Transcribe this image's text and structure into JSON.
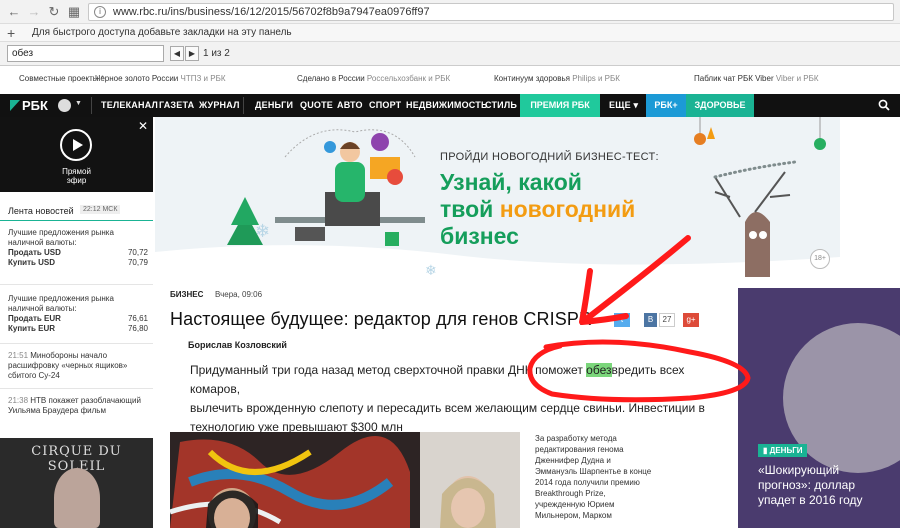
{
  "browser": {
    "url": "www.rbc.ru/ins/business/16/12/2015/56702f8b9a7947ea0976ff97",
    "bookmarks_hint": "Для быстрого доступа добавьте закладки на эту панель",
    "find": {
      "query": "обез",
      "count": "1 из 2"
    }
  },
  "promos": [
    {
      "label": "Совместные проекты",
      "mark": "*",
      "sub": ""
    },
    {
      "label": "Черное золото России",
      "mark": "",
      "sub": "ЧТПЗ и РБК"
    },
    {
      "label": "Сделано в России",
      "mark": "",
      "sub": "Россельхозбанк и РБК"
    },
    {
      "label": "Континуум здоровья",
      "mark": "",
      "sub": "Philips и РБК"
    },
    {
      "label": "Паблик чат РБК Viber",
      "mark": "",
      "sub": "Viber и РБК"
    }
  ],
  "nav": {
    "logo": "РБК",
    "items": [
      "ТЕЛЕКАНАЛ",
      "ГАЗЕТА",
      "ЖУРНАЛ",
      "ДЕНЬГИ",
      "QUOTE",
      "АВТО",
      "СПОРТ",
      "НЕДВИЖИМОСТЬ",
      "СТИЛЬ"
    ],
    "premium": "ПРЕМИЯ РБК",
    "more": "ЕЩЕ",
    "plus": "РБК+",
    "health": "ЗДОРОВЬЕ"
  },
  "live": {
    "label_1": "Прямой",
    "label_2": "эфир"
  },
  "news": {
    "heading": "Лента новостей",
    "time_badge": "22:12 МСК",
    "usd": {
      "title_1": "Лучшие предложения рынка",
      "title_2": "наличной валюты:",
      "sell_label": "Продать USD",
      "sell_value": "70,72",
      "buy_label": "Купить USD",
      "buy_value": "70,79"
    },
    "eur": {
      "title_1": "Лучшие предложения рынка",
      "title_2": "наличной валюты:",
      "sell_label": "Продать EUR",
      "sell_value": "76,61",
      "buy_label": "Купить EUR",
      "buy_value": "76,80"
    },
    "items": [
      {
        "time": "21:51",
        "text_1": "Минобороны начало",
        "text_2": "расшифровку «черных ящиков»",
        "text_3": "сбитого Су-24"
      },
      {
        "time": "21:38",
        "text_1": "НТВ покажет разоблачающий",
        "text_2": "Уильяма Браудера фильм",
        "text_3": ""
      }
    ],
    "ad_title": "CIRQUE DU SOLEIL"
  },
  "banner": {
    "kicker": "ПРОЙДИ НОВОГОДНИЙ БИЗНЕС-ТЕСТ:",
    "line1": "Узнай, какой",
    "line2_a": "твой ",
    "line2_b": "новогодний",
    "line3": "бизнес",
    "age": "18+"
  },
  "article": {
    "rubric": "БИЗНЕС",
    "date": "Вчера, 09:06",
    "title": "Настоящее будущее: редактор для генов CRISPR",
    "share_vk_count": "27",
    "author": "Борислав Козловский",
    "lead_1": "Придуманный три года назад метод сверхточной правки ДНК поможет ",
    "lead_hl": "обез",
    "lead_2": "вредить всех комаров,",
    "lead_3": "вылечить врожденную слепоту и пересадить всем желающим сердце свиньи. Инвестиции в",
    "lead_4": "технологию уже превышают $300 млн",
    "caption": [
      "За разработку метода",
      "редактирования генома",
      "Дженнифер Дудна и",
      "Эммануэль Шарпентье в конце",
      "2014 года получили премию",
      "Breakthrough Prize,",
      "учрежденную Юрием",
      "Мильнером, Марком"
    ]
  },
  "right_ad": {
    "badge": "ДЕНЬГИ",
    "text": "«Шокирующий прогноз»: доллар упадет в 2016 году"
  },
  "colors": {
    "brand_green": "#1ab394",
    "annotation_red": "#ff1a1a",
    "highlight": "#7bd67b",
    "nav_bg": "#111111"
  }
}
